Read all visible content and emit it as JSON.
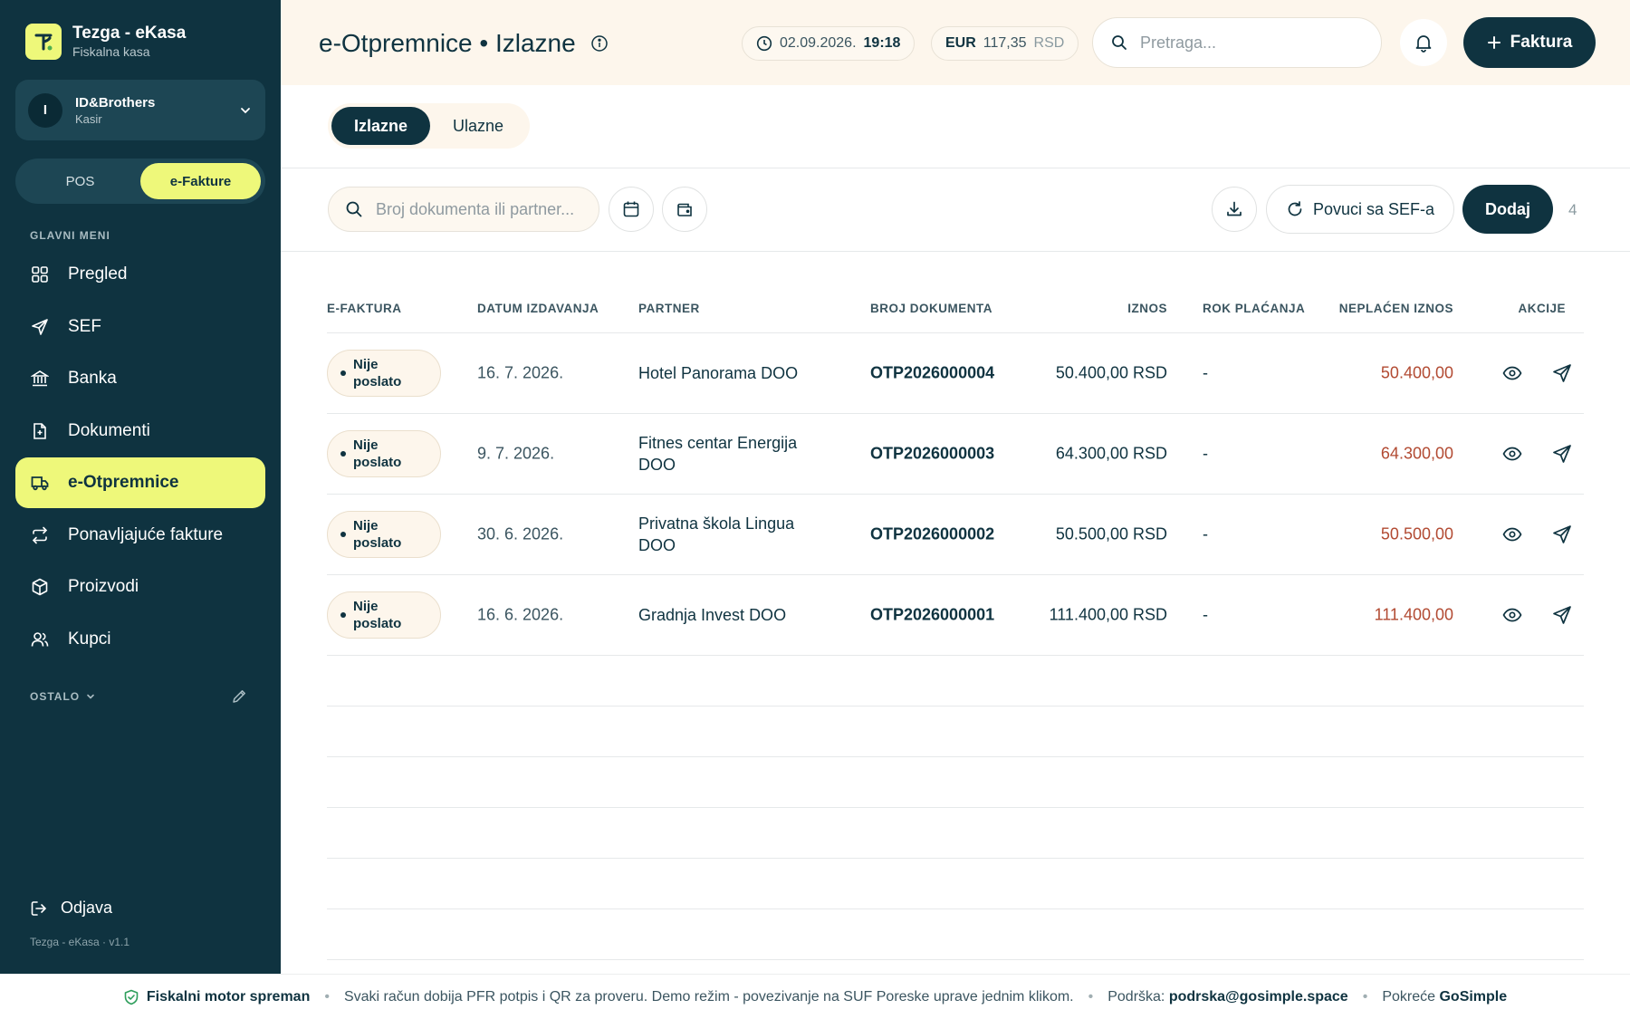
{
  "brand": {
    "name": "Tezga - eKasa",
    "subtitle": "Fiskalna kasa"
  },
  "account": {
    "initial": "I",
    "name": "ID&Brothers",
    "role": "Kasir"
  },
  "mode_switch": {
    "pos": "POS",
    "efakture": "e-Fakture",
    "active": "e-Fakture"
  },
  "sidebar": {
    "main_label": "GLAVNI MENI",
    "items": [
      {
        "label": "Pregled",
        "icon": "grid-icon"
      },
      {
        "label": "SEF",
        "icon": "send-icon"
      },
      {
        "label": "Banka",
        "icon": "bank-icon"
      },
      {
        "label": "Dokumenti",
        "icon": "document-icon"
      },
      {
        "label": "e-Otpremnice",
        "icon": "truck-icon",
        "active": true
      },
      {
        "label": "Ponavljajuće fakture",
        "icon": "repeat-icon"
      },
      {
        "label": "Proizvodi",
        "icon": "box-icon"
      },
      {
        "label": "Kupci",
        "icon": "users-icon"
      }
    ],
    "other_label": "OSTALO",
    "logout": "Odjava",
    "version": "Tezga - eKasa · v1.1"
  },
  "header": {
    "title": "e-Otpremnice • Izlazne",
    "date": "02.09.2026.",
    "time": "19:18",
    "rate_currency": "EUR",
    "rate_value": "117,35",
    "rate_unit": "RSD",
    "search_placeholder": "Pretraga...",
    "new_invoice": "Faktura"
  },
  "tabs": {
    "outgoing": "Izlazne",
    "incoming": "Ulazne",
    "active": "Izlazne"
  },
  "toolbar": {
    "search_placeholder": "Broj dokumenta ili partner...",
    "sef_button": "Povuci sa SEF-a",
    "add_button": "Dodaj",
    "count": "4"
  },
  "table": {
    "headers": {
      "efaktura": "E-FAKTURA",
      "date": "DATUM IZDAVANJA",
      "partner": "PARTNER",
      "doc": "BROJ DOKUMENTA",
      "amount": "IZNOS",
      "due": "ROK PLAĆANJA",
      "unpaid": "NEPLAĆEN IZNOS",
      "actions": "AKCIJE"
    },
    "rows": [
      {
        "status": "Nije poslato",
        "date": "16. 7. 2026.",
        "partner": "Hotel Panorama DOO",
        "doc": "OTP2026000004",
        "amount": "50.400,00 RSD",
        "due": "-",
        "unpaid": "50.400,00"
      },
      {
        "status": "Nije poslato",
        "date": "9. 7. 2026.",
        "partner": "Fitnes centar Energija DOO",
        "doc": "OTP2026000003",
        "amount": "64.300,00 RSD",
        "due": "-",
        "unpaid": "64.300,00"
      },
      {
        "status": "Nije poslato",
        "date": "30. 6. 2026.",
        "partner": "Privatna škola Lingua DOO",
        "doc": "OTP2026000002",
        "amount": "50.500,00 RSD",
        "due": "-",
        "unpaid": "50.500,00"
      },
      {
        "status": "Nije poslato",
        "date": "16. 6. 2026.",
        "partner": "Gradnja Invest DOO",
        "doc": "OTP2026000001",
        "amount": "111.400,00 RSD",
        "due": "-",
        "unpaid": "111.400,00"
      }
    ]
  },
  "footer": {
    "engine_status": "Fiskalni motor spreman",
    "message": "Svaki račun dobija PFR potpis i QR za proveru. Demo režim - povezivanje na SUF Poreske uprave jednim klikom.",
    "support_label": "Podrška:",
    "support_email": "podrska@gosimple.space",
    "powered_label": "Pokreće",
    "powered_by": "GoSimple"
  },
  "colors": {
    "sidebar": "#0f3340",
    "accent": "#eef87a",
    "header_bg": "#fdf6ec",
    "unpaid": "#b24a32"
  }
}
